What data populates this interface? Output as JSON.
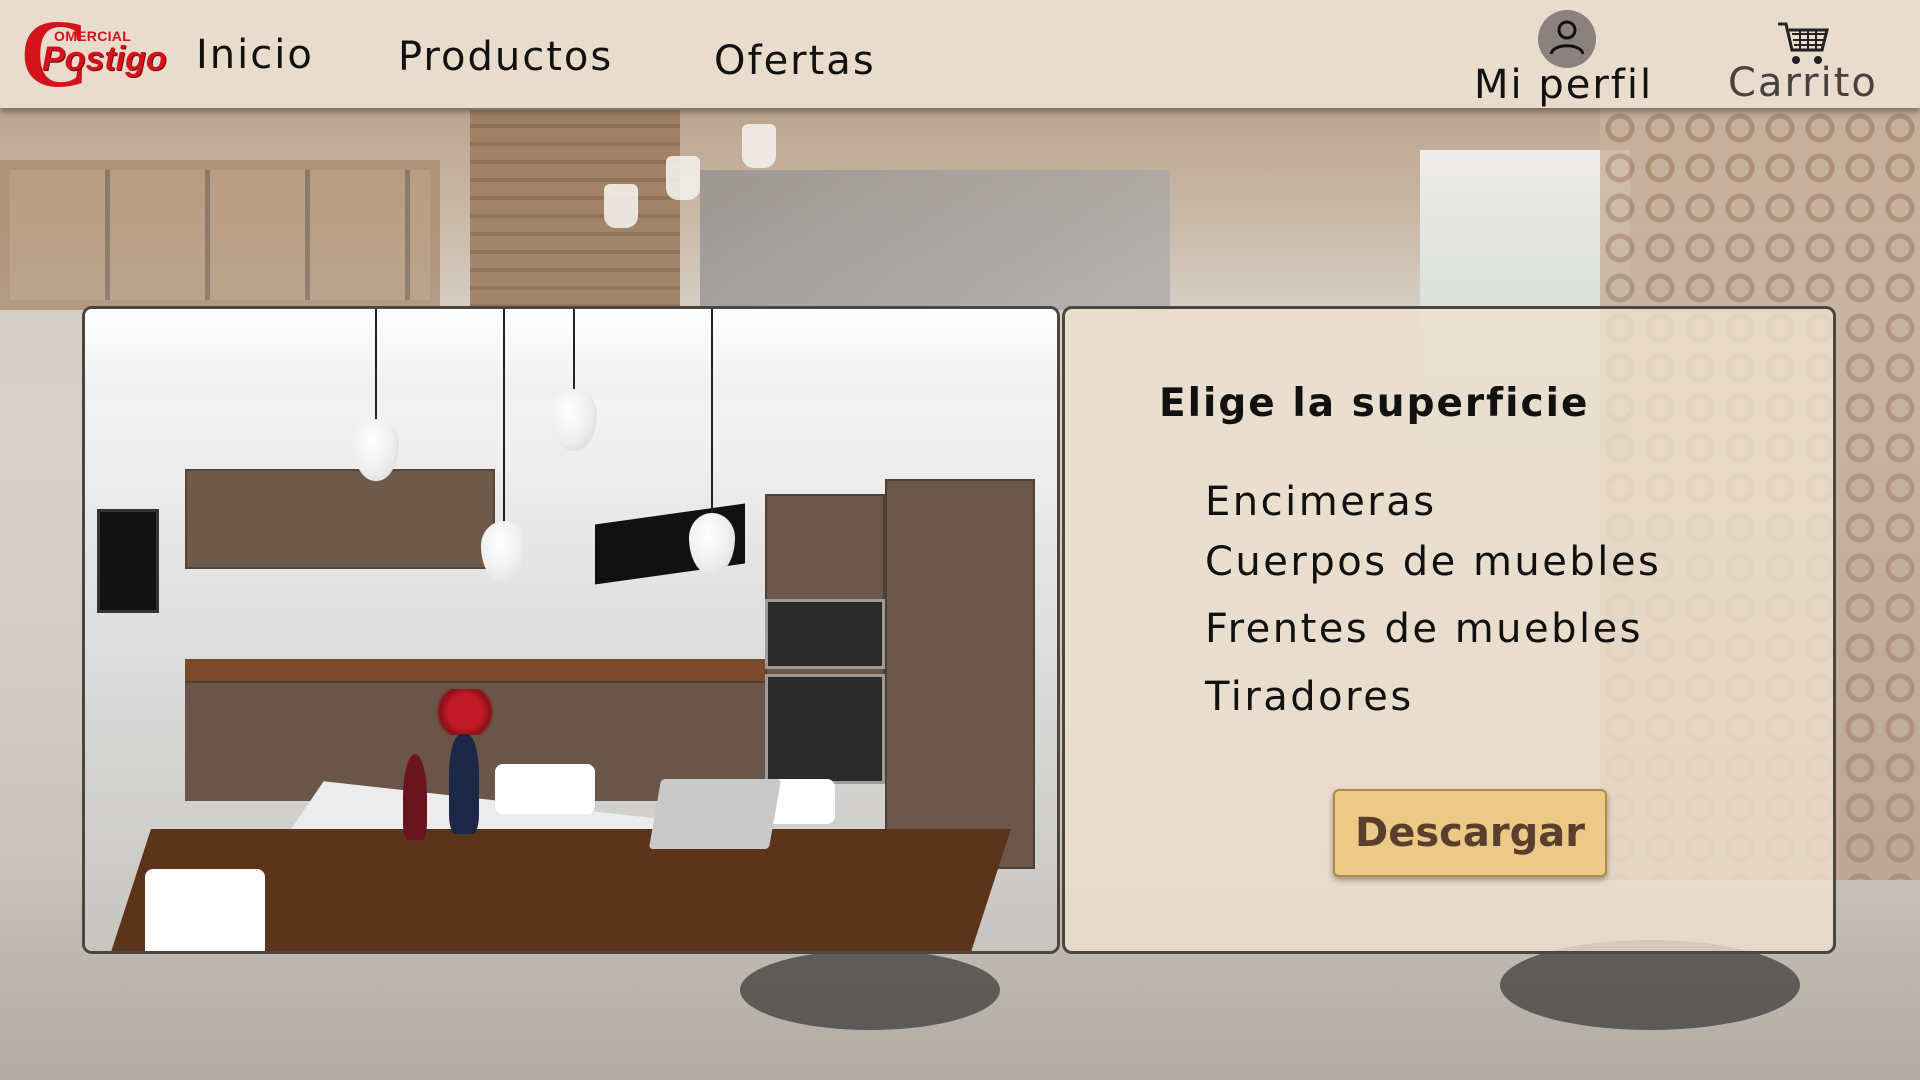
{
  "brand": {
    "logo_top": "OMERCIAL",
    "logo_main": "Postigo",
    "logo_letter": "C",
    "accent_color": "#d3121b"
  },
  "nav": {
    "items": [
      {
        "label": "Inicio"
      },
      {
        "label": "Productos"
      },
      {
        "label": "Ofertas"
      }
    ],
    "profile_label": "Mi perfil",
    "profile_icon": "user-icon",
    "cart_label": "Carrito",
    "cart_icon": "cart-icon"
  },
  "panel": {
    "title": "Elige la superficie",
    "options": [
      {
        "label": "Encimeras"
      },
      {
        "label": "Cuerpos de muebles"
      },
      {
        "label": "Frentes de muebles"
      },
      {
        "label": "Tiradores"
      }
    ],
    "button_label": "Descargar",
    "button_color": "#ecc984"
  },
  "colors": {
    "header_bg": "#e9dccc",
    "panel_bg": "#eee0d0",
    "border": "#4d4540"
  }
}
